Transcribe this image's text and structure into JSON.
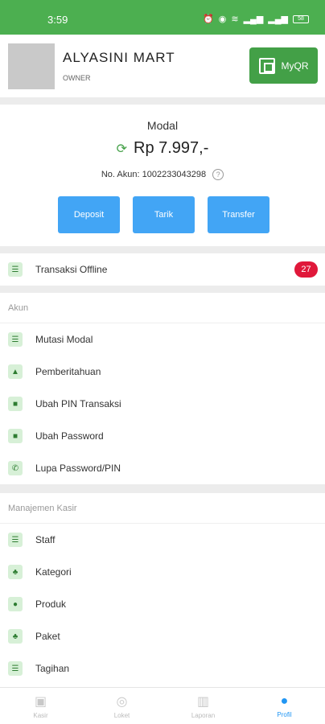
{
  "status_bar": {
    "time": "3:59",
    "battery": "58"
  },
  "header": {
    "store_name": "ALYASINI MART",
    "role": "OWNER",
    "myqr_label": "MyQR"
  },
  "modal": {
    "title": "Modal",
    "balance": "Rp 7.997,-",
    "account": "No. Akun: 1002233043298",
    "actions": [
      "Deposit",
      "Tarik",
      "Transfer"
    ]
  },
  "offline": {
    "label": "Transaksi Offline",
    "count": "27"
  },
  "akun": {
    "header": "Akun",
    "items": [
      {
        "label": "Mutasi Modal",
        "icon": "list-icon"
      },
      {
        "label": "Pemberitahuan",
        "icon": "bell-icon"
      },
      {
        "label": "Ubah PIN Transaksi",
        "icon": "lock-icon"
      },
      {
        "label": "Ubah Password",
        "icon": "lock-icon"
      },
      {
        "label": "Lupa Password/PIN",
        "icon": "phone-icon"
      }
    ]
  },
  "manajemen": {
    "header": "Manajemen Kasir",
    "items": [
      {
        "label": "Staff",
        "icon": "list-icon"
      },
      {
        "label": "Kategori",
        "icon": "category-icon"
      },
      {
        "label": "Produk",
        "icon": "product-icon"
      },
      {
        "label": "Paket",
        "icon": "package-icon"
      },
      {
        "label": "Tagihan",
        "icon": "list-icon"
      }
    ]
  },
  "bottom_nav": [
    {
      "label": "Kasir",
      "icon": "cashier-icon"
    },
    {
      "label": "Loket",
      "icon": "counter-icon"
    },
    {
      "label": "Laporan",
      "icon": "chart-icon"
    },
    {
      "label": "Profil",
      "icon": "profile-icon",
      "active": true
    }
  ]
}
